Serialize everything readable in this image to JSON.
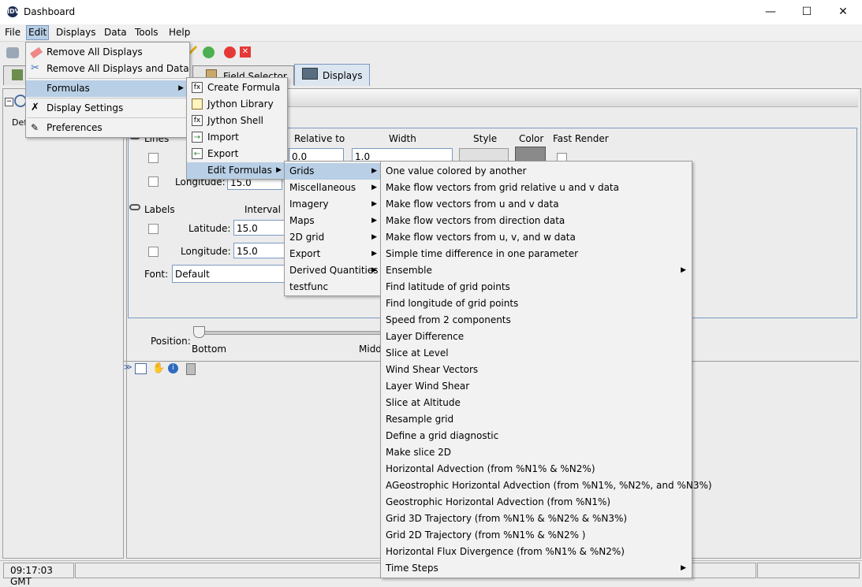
{
  "window": {
    "title": "Dashboard",
    "icon": "app-logo-icon",
    "buttons": [
      "minimize",
      "maximize",
      "close"
    ]
  },
  "menubar": {
    "items": [
      "File",
      "Edit",
      "Displays",
      "Data",
      "Tools",
      "Help"
    ],
    "active": "Edit"
  },
  "tabs": [
    {
      "label": "Field Selector",
      "icon": "clipboard-icon"
    },
    {
      "label": "Displays",
      "icon": "monitor-icon",
      "active": true
    }
  ],
  "left_panel": {
    "tree_label": "Def"
  },
  "settings": {
    "lines_label": "Lines",
    "headers": {
      "relative_to": "Relative to",
      "width": "Width",
      "style": "Style",
      "color": "Color",
      "fast_render": "Fast Render"
    },
    "relative_value": "0.0",
    "width_value": "1.0",
    "line_lon_label": "Longitude:",
    "line_lon_value": "15.0",
    "labels_label": "Labels",
    "interval_label": "Interval",
    "lat_label": "Latitude:",
    "lat_value": "15.0",
    "lon_label": "Longitude:",
    "lon_value": "15.0",
    "font_label": "Font:",
    "font_value": "Default",
    "position_label": "Position:",
    "position_bottom": "Bottom",
    "position_middle": "Midd"
  },
  "status": {
    "time": "09:17:03 GMT"
  },
  "edit_menu": [
    {
      "label": "Remove All Displays",
      "icon": "eraser-icon"
    },
    {
      "label": "Remove All Displays and Data",
      "icon": "scissors-icon"
    },
    {
      "label": "Formulas",
      "submenu": true,
      "selected": true
    },
    {
      "label": "Display Settings",
      "icon": "wrench-icon"
    },
    {
      "label": "Preferences",
      "icon": "preferences-icon"
    }
  ],
  "formulas_menu": [
    {
      "label": "Create Formula",
      "icon": "formula-icon"
    },
    {
      "label": "Jython Library",
      "icon": "pencil-icon"
    },
    {
      "label": "Jython Shell",
      "icon": "formula-icon"
    },
    {
      "label": "Import",
      "icon": "import-icon"
    },
    {
      "label": "Export",
      "icon": "export-icon"
    },
    {
      "label": "Edit Formulas",
      "submenu": true,
      "selected": true
    }
  ],
  "edit_formulas_menu": [
    {
      "label": "Grids",
      "submenu": true,
      "selected": true
    },
    {
      "label": "Miscellaneous",
      "submenu": true
    },
    {
      "label": "Imagery",
      "submenu": true
    },
    {
      "label": "Maps",
      "submenu": true
    },
    {
      "label": "2D grid",
      "submenu": true
    },
    {
      "label": "Export",
      "submenu": true
    },
    {
      "label": "Derived Quantities",
      "submenu": true
    },
    {
      "label": "testfunc"
    }
  ],
  "grids_menu": [
    "One value colored by another",
    "Make flow vectors from grid relative u and v data",
    "Make flow vectors from u and v data",
    "Make flow vectors from direction data",
    "Make flow vectors from u, v, and w data",
    "Simple time difference in one parameter",
    "Ensemble",
    "Find latitude of grid points",
    "Find longitude of grid points",
    "Speed from 2 components",
    "Layer Difference",
    "Slice at Level",
    "Wind Shear Vectors",
    "Layer Wind Shear",
    "Slice at Altitude",
    "Resample grid",
    "Define a grid diagnostic",
    "Make slice 2D",
    "Horizontal Advection (from %N1% & %N2%)",
    "AGeostrophic Horizontal Advection (from %N1%, %N2%, and %N3%)",
    "Geostrophic Horizontal Advection (from %N1%)",
    "Grid 3D Trajectory (from %N1% & %N2% & %N3%)",
    "Grid 2D Trajectory (from %N1% & %N2% )",
    "Horizontal Flux Divergence (from %N1% & %N2%)",
    "Time Steps"
  ],
  "grids_submenus": [
    "Ensemble",
    "Time Steps"
  ],
  "colors": {
    "menu_selection": "#b8cfe5",
    "border_accent": "#7a9ac0"
  }
}
